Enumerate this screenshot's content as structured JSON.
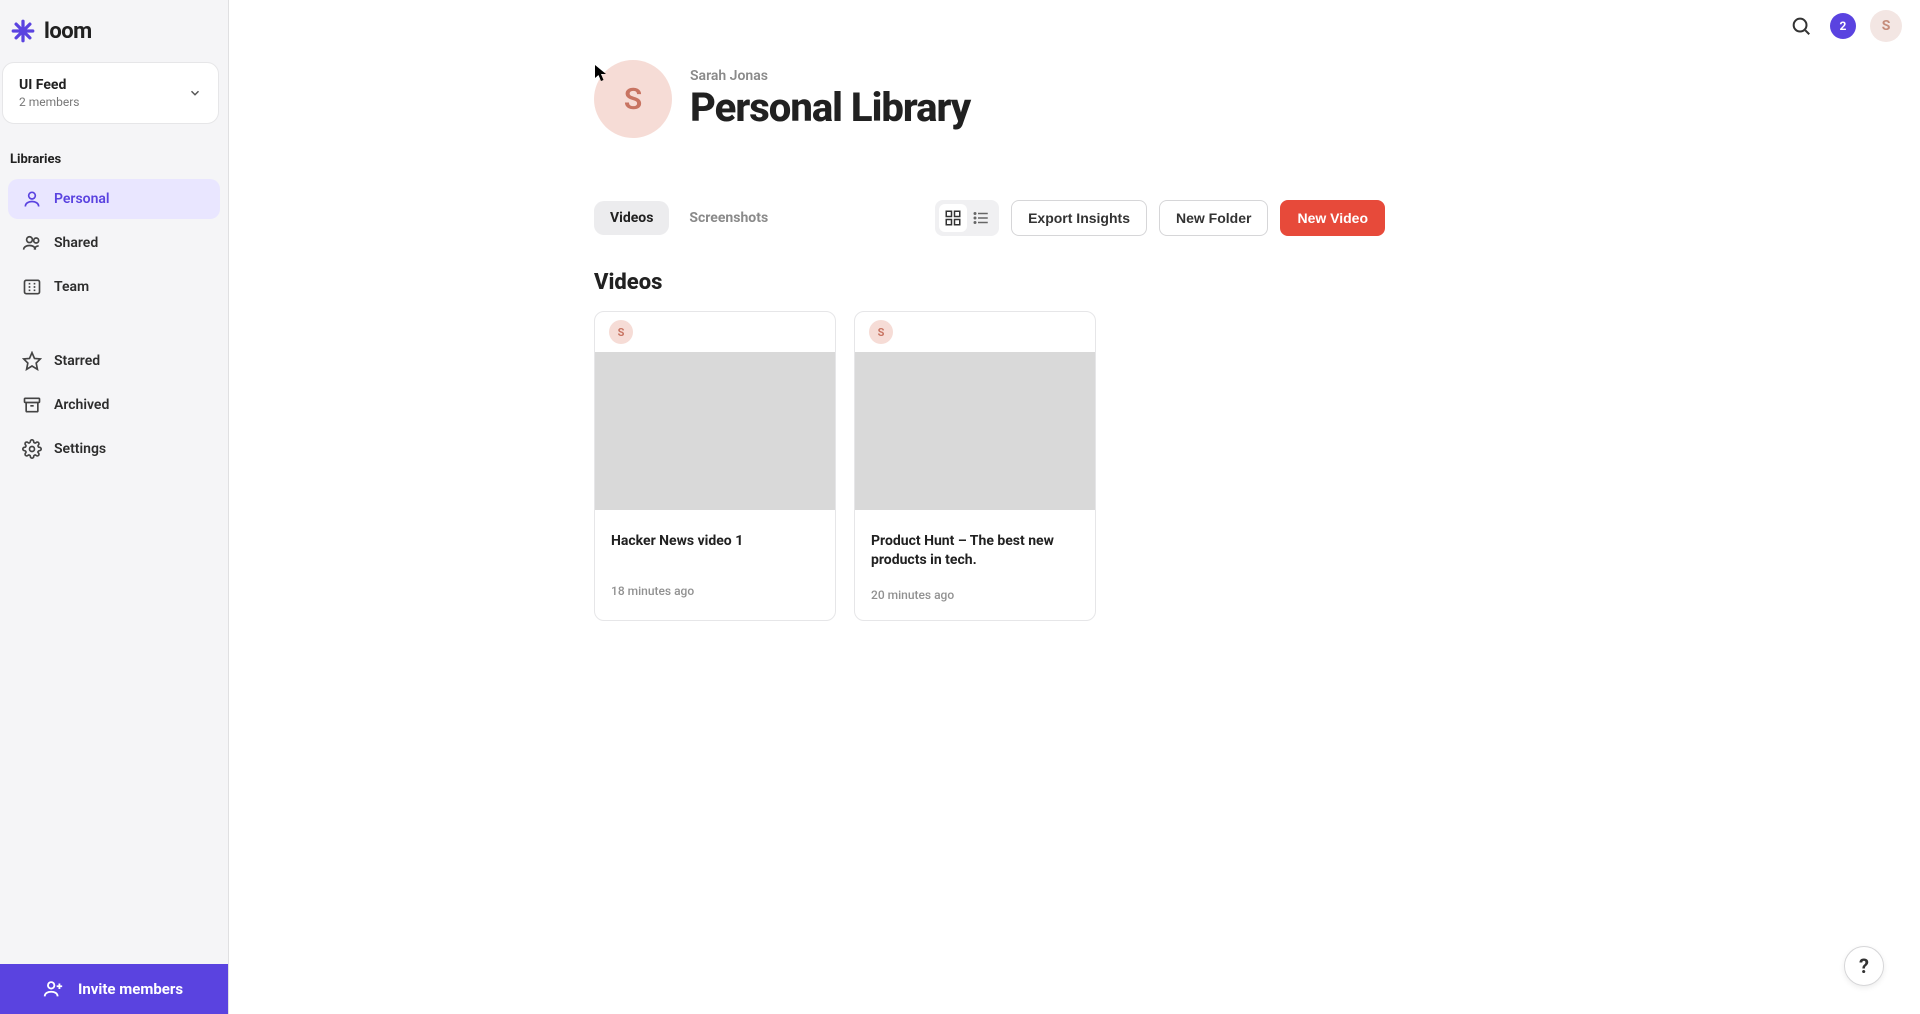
{
  "brand": {
    "name": "loom"
  },
  "workspace": {
    "name": "UI Feed",
    "members_label": "2 members"
  },
  "sidebar": {
    "section_label": "Libraries",
    "items": [
      {
        "label": "Personal"
      },
      {
        "label": "Shared"
      },
      {
        "label": "Team"
      }
    ],
    "secondary": [
      {
        "label": "Starred"
      },
      {
        "label": "Archived"
      },
      {
        "label": "Settings"
      }
    ],
    "invite_label": "Invite members"
  },
  "topbar": {
    "notif_count": "2",
    "avatar_initial": "S"
  },
  "header": {
    "avatar_initial": "S",
    "owner": "Sarah Jonas",
    "title": "Personal Library"
  },
  "tabs": [
    {
      "label": "Videos"
    },
    {
      "label": "Screenshots"
    }
  ],
  "actions": {
    "export": "Export Insights",
    "new_folder": "New Folder",
    "new_video": "New Video"
  },
  "section_heading": "Videos",
  "videos": [
    {
      "initial": "S",
      "title": "Hacker News video 1",
      "time": "18 minutes ago"
    },
    {
      "initial": "S",
      "title": "Product Hunt – The best new products in tech.",
      "time": "20 minutes ago"
    }
  ],
  "help_label": "?"
}
